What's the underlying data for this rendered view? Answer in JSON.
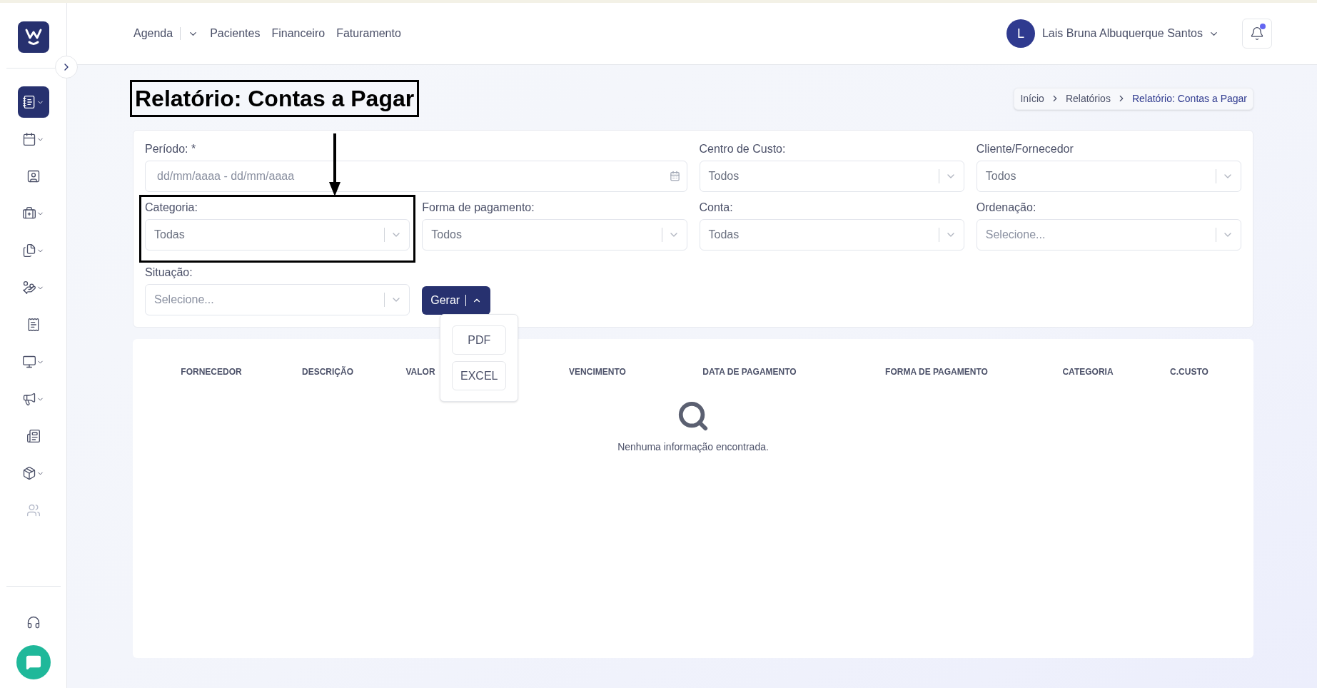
{
  "sidebar": {
    "items": [
      {
        "selected": true,
        "has_submenu": true,
        "disabled": false
      },
      {
        "selected": false,
        "has_submenu": true,
        "disabled": false
      },
      {
        "selected": false,
        "has_submenu": false,
        "disabled": false
      },
      {
        "selected": false,
        "has_submenu": true,
        "disabled": false
      },
      {
        "selected": false,
        "has_submenu": true,
        "disabled": false
      },
      {
        "selected": false,
        "has_submenu": true,
        "disabled": false
      },
      {
        "selected": false,
        "has_submenu": false,
        "disabled": false
      },
      {
        "selected": false,
        "has_submenu": true,
        "disabled": false
      },
      {
        "selected": false,
        "has_submenu": true,
        "disabled": false
      },
      {
        "selected": false,
        "has_submenu": false,
        "disabled": false
      },
      {
        "selected": false,
        "has_submenu": true,
        "disabled": false
      },
      {
        "selected": false,
        "has_submenu": false,
        "disabled": true
      }
    ]
  },
  "top_nav": [
    {
      "label": "Agenda",
      "has_dropdown": true
    },
    {
      "label": "Pacientes",
      "has_dropdown": false
    },
    {
      "label": "Financeiro",
      "has_dropdown": false
    },
    {
      "label": "Faturamento",
      "has_dropdown": false
    }
  ],
  "user": {
    "initial": "L",
    "name": "Lais Bruna Albuquerque Santos"
  },
  "notifications": {
    "unread": true
  },
  "page": {
    "title": "Relatório: Contas a Pagar",
    "highlighted": true
  },
  "breadcrumb": [
    {
      "label": "Início",
      "current": false
    },
    {
      "label": "Relatórios",
      "current": false
    },
    {
      "label": "Relatório: Contas a Pagar",
      "current": true
    }
  ],
  "filters": [
    {
      "kind": "date_range",
      "label": "Período: *",
      "placeholder": "dd/mm/aaaa - dd/mm/aaaa",
      "highlighted": false
    },
    {
      "kind": "select",
      "label": "Centro de Custo:",
      "value": "Todos",
      "highlighted": false
    },
    {
      "kind": "select",
      "label": "Cliente/Fornecedor",
      "value": "Todos",
      "highlighted": false
    },
    {
      "kind": "select",
      "label": "Categoria:",
      "value": "Todas",
      "highlighted": true
    },
    {
      "kind": "select",
      "label": "Forma de pagamento:",
      "value": "Todos",
      "highlighted": false
    },
    {
      "kind": "select",
      "label": "Conta:",
      "value": "Todas",
      "highlighted": false
    },
    {
      "kind": "select",
      "label": "Ordenação:",
      "placeholder": "Selecione...",
      "highlighted": false
    },
    {
      "kind": "select",
      "label": "Situação:",
      "placeholder": "Selecione...",
      "highlighted": false
    }
  ],
  "generate": {
    "label": "Gerar",
    "expanded": true,
    "options": [
      "PDF",
      "EXCEL"
    ]
  },
  "table": {
    "columns": [
      "FORNECEDOR",
      "DESCRIÇÃO",
      "VALOR",
      "VENCIMENTO",
      "DATA DE PAGAMENTO",
      "FORMA DE PAGAMENTO",
      "CATEGORIA",
      "C.CUSTO"
    ],
    "empty_message": "Nenhuma informação encontrada."
  }
}
